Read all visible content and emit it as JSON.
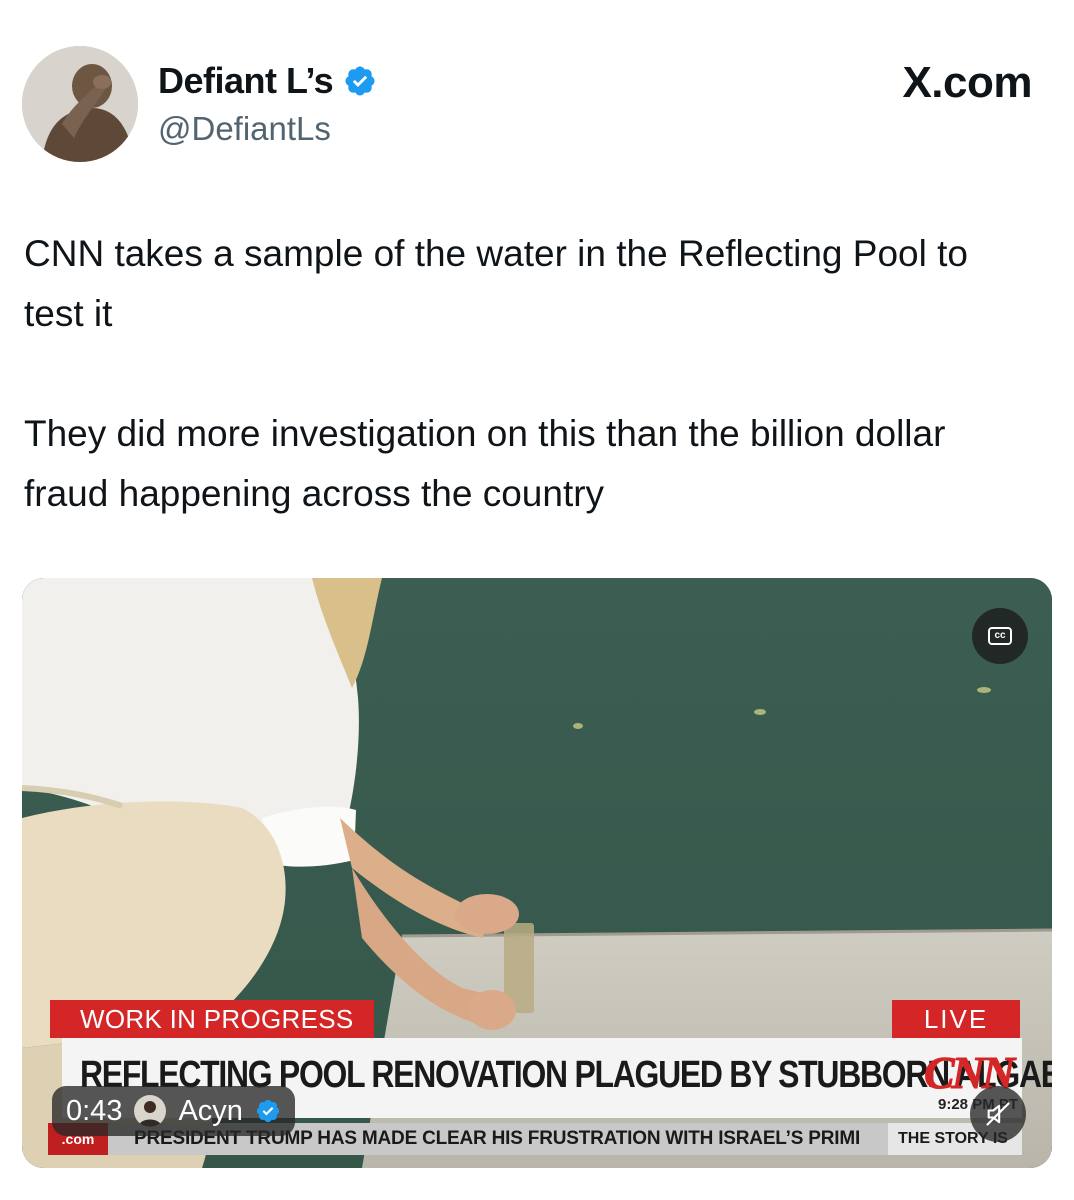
{
  "author": {
    "display_name": "Defiant L’s",
    "handle": "@DefiantLs",
    "verified": true
  },
  "site_label": "X.com",
  "tweet": {
    "paragraphs": [
      "CNN takes a sample of the water in the Reflecting Pool to test it",
      "They did more investigation on this than the billion dollar fraud happening across the country"
    ]
  },
  "media": {
    "type": "video",
    "captions_icon": "cc-icon",
    "chyron": {
      "tag": "WORK IN PROGRESS",
      "live": "LIVE",
      "headline": "REFLECTING POOL RENOVATION PLAGUED BY STUBBORN ALGAE",
      "network": "CNN",
      "time": "9:28 PM PT",
      "ticker_left": ".com",
      "ticker": "PRESIDENT TRUMP HAS MADE CLEAR HIS FRUSTRATION WITH ISRAEL’S PRIMI",
      "story": "THE STORY IS"
    },
    "overlay": {
      "elapsed": "0:43",
      "source": "Acyn",
      "source_verified": true,
      "mute_icon": "muted-speaker-icon"
    }
  },
  "colors": {
    "verified_blue": "#1d9bf0",
    "cnn_red": "#d42626",
    "handle_gray": "#536471"
  }
}
